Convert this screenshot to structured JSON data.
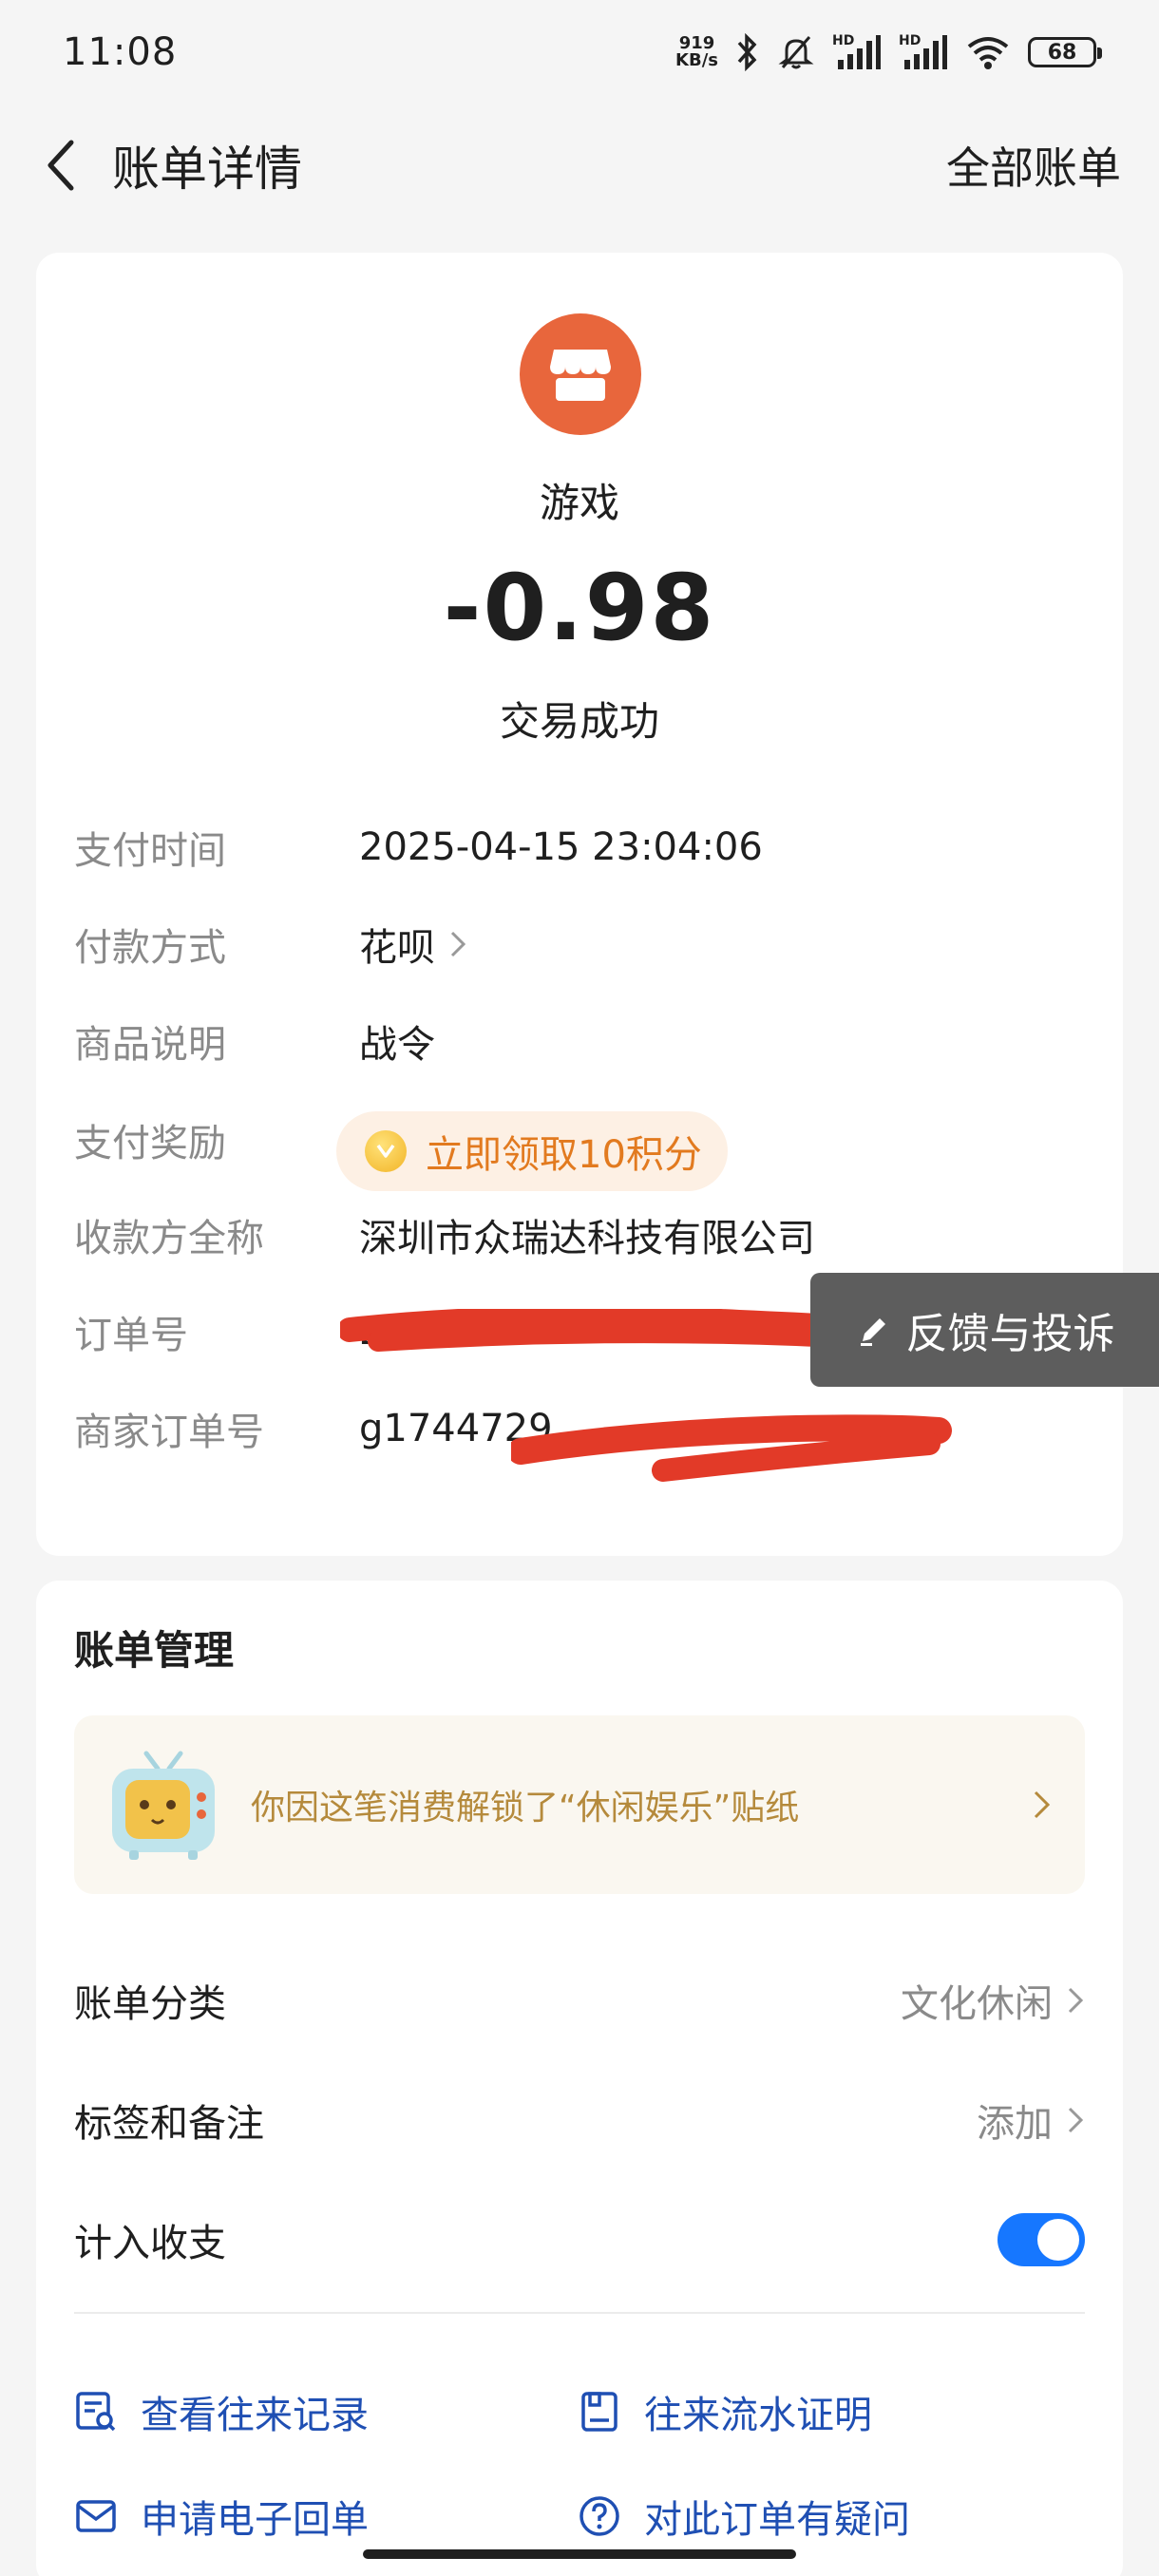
{
  "status_bar": {
    "time": "11:08",
    "net_speed_value": "919",
    "net_speed_unit": "KB/s",
    "hd1": "HD",
    "hd2": "HD",
    "battery": "68"
  },
  "nav": {
    "title": "账单详情",
    "right_link": "全部账单"
  },
  "summary": {
    "merchant": "游戏",
    "amount": "-0.98",
    "status": "交易成功",
    "icon_color": "#e8663c"
  },
  "details": [
    {
      "label": "支付时间",
      "value": "2025-04-15 23:04:06"
    },
    {
      "label": "付款方式",
      "value": "花呗"
    },
    {
      "label": "商品说明",
      "value": "战令"
    },
    {
      "label": "支付奖励",
      "value": "立即领取10积分"
    },
    {
      "label": "收款方全称",
      "value": "深圳市众瑞达科技有限公司"
    },
    {
      "label": "订单号",
      "value": "2"
    },
    {
      "label": "商家订单号",
      "value": "g1744729"
    }
  ],
  "feedback": {
    "label": "反馈与投诉"
  },
  "manage": {
    "title": "账单管理",
    "sticker_text": "你因这笔消费解锁了“休闲娱乐”贴纸",
    "rows": [
      {
        "label": "账单分类",
        "value": "文化休闲"
      },
      {
        "label": "标签和备注",
        "value": "添加"
      },
      {
        "label": "计入收支",
        "value": ""
      }
    ],
    "include_in_stats": true,
    "actions": [
      {
        "label": "查看往来记录",
        "icon": "record-icon"
      },
      {
        "label": "往来流水证明",
        "icon": "certificate-icon"
      },
      {
        "label": "申请电子回单",
        "icon": "mail-icon"
      },
      {
        "label": "对此订单有疑问",
        "icon": "question-icon"
      }
    ]
  },
  "colors": {
    "accent_blue": "#1677ff",
    "action_text": "#1f4fb3",
    "scribble_red": "#e23a28"
  }
}
